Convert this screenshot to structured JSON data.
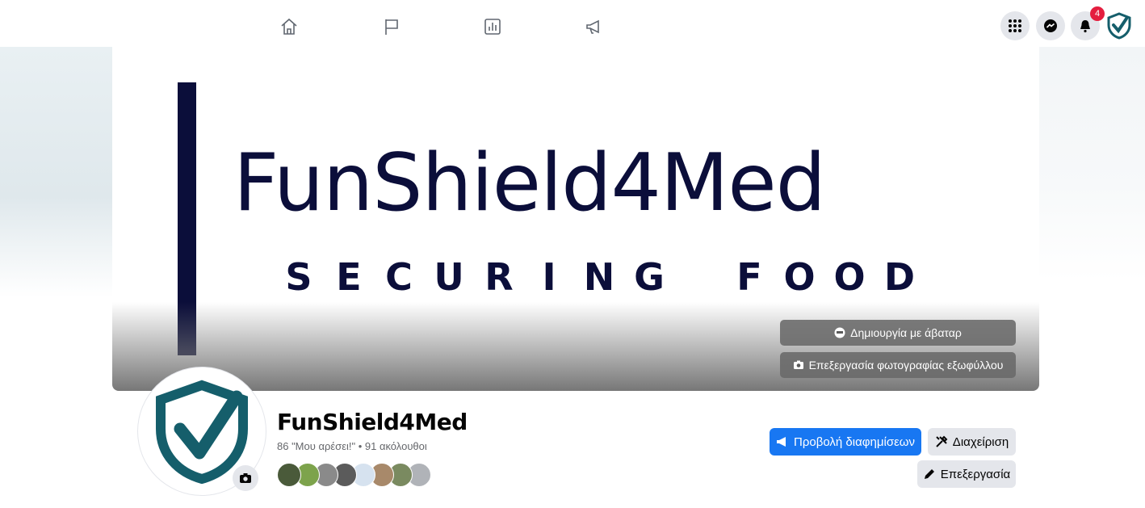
{
  "nav": {
    "icons": [
      "home-icon",
      "flag-icon",
      "insights-icon",
      "megaphone-icon"
    ],
    "menu_icon": "grid-menu-icon",
    "messenger_icon": "messenger-icon",
    "notifications_icon": "bell-icon",
    "notifications_count": "4",
    "account_icon": "shield-check-icon"
  },
  "cover": {
    "title": "FunShield4Med",
    "tagline_letters": [
      "S",
      "E",
      "C",
      "U",
      "R",
      "I",
      "N",
      "G",
      " ",
      "F",
      "O",
      "O",
      "D"
    ],
    "avatar_button": "Δημιουργία με άβαταρ",
    "edit_cover_button": "Επεξεργασία φωτογραφίας εξωφύλλου"
  },
  "profile": {
    "name": "FunShield4Med",
    "stats": "86 \"Μου αρέσει!\" • 91 ακόλουθοι",
    "fans": 8,
    "fan_colors": [
      "#4a5a3a",
      "#7da34c",
      "#8a8a8a",
      "#5b5b5b",
      "#d6e2ef",
      "#a8896a",
      "#7a8a60",
      "#b0b3b8"
    ]
  },
  "actions": {
    "promote": "Προβολή διαφημίσεων",
    "manage": "Διαχείριση",
    "edit": "Επεξεργασία"
  },
  "colors": {
    "brand_navy": "#0b0e3a",
    "shield_teal": "#155e6b",
    "facebook_blue": "#1877f2"
  }
}
